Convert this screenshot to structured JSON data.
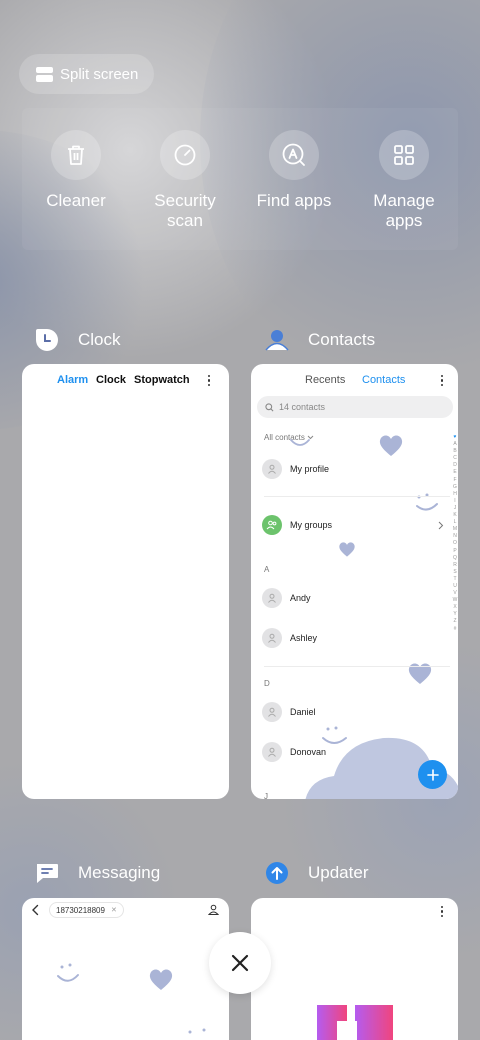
{
  "split_screen": {
    "label": "Split screen"
  },
  "quick_actions": [
    {
      "label": "Cleaner",
      "icon": "trash-icon"
    },
    {
      "label": "Security\nscan",
      "icon": "security-scan-icon"
    },
    {
      "label": "Find apps",
      "icon": "find-apps-icon"
    },
    {
      "label": "Manage\napps",
      "icon": "grid-icon"
    }
  ],
  "recent_apps": [
    {
      "name": "Clock",
      "icon": "clock-icon",
      "tabs": [
        "Alarm",
        "Clock",
        "Stopwatch"
      ],
      "active_tab": "Alarm"
    },
    {
      "name": "Contacts",
      "icon": "contacts-icon",
      "tabs": [
        "Recents",
        "Contacts"
      ],
      "active_tab": "Contacts",
      "search_placeholder": "14 contacts",
      "filter_label": "All contacts",
      "rows": {
        "profile": "My profile",
        "groups": "My groups",
        "section_a": "A",
        "andy": "Andy",
        "ashley": "Ashley",
        "section_d": "D",
        "daniel": "Daniel",
        "donovan": "Donovan",
        "section_j": "J"
      },
      "alphabet": [
        "♥",
        "A",
        "B",
        "C",
        "D",
        "E",
        "F",
        "G",
        "H",
        "I",
        "J",
        "K",
        "L",
        "M",
        "N",
        "O",
        "P",
        "Q",
        "R",
        "S",
        "T",
        "U",
        "V",
        "W",
        "X",
        "Y",
        "Z",
        "#"
      ]
    },
    {
      "name": "Messaging",
      "icon": "messaging-icon",
      "recipient": "18730218809"
    },
    {
      "name": "Updater",
      "icon": "updater-icon"
    }
  ],
  "colors": {
    "accent_blue": "#1e90ef",
    "group_green": "#6cc36c",
    "decor_periwinkle": "#aab4d6"
  }
}
